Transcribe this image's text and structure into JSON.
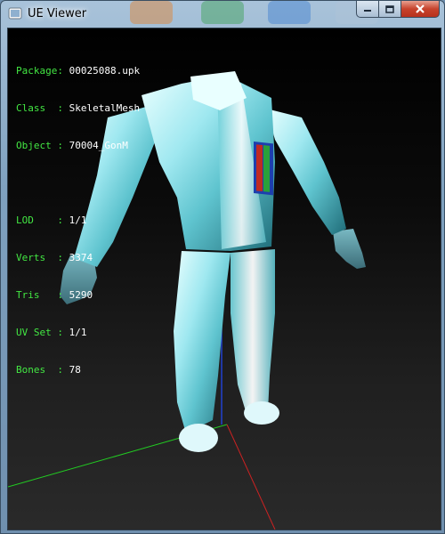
{
  "window": {
    "title": "UE Viewer"
  },
  "info": {
    "package": {
      "label": "Package: ",
      "value": "00025088.upk"
    },
    "class": {
      "label": "Class  : ",
      "value": "SkeletalMesh"
    },
    "object": {
      "label": "Object : ",
      "value": "70004_GonM"
    },
    "lod": {
      "label": "LOD    : ",
      "value": "1/1"
    },
    "verts": {
      "label": "Verts  : ",
      "value": "3374"
    },
    "tris": {
      "label": "Tris   : ",
      "value": "5290"
    },
    "uvset": {
      "label": "UV Set : ",
      "value": "1/1"
    },
    "bones": {
      "label": "Bones  : ",
      "value": "78"
    }
  },
  "colors": {
    "label": "#43e843",
    "value": "#ffffff",
    "axis_x": "#cc2222",
    "axis_y": "#22cc22",
    "axis_z": "#2244dd"
  }
}
